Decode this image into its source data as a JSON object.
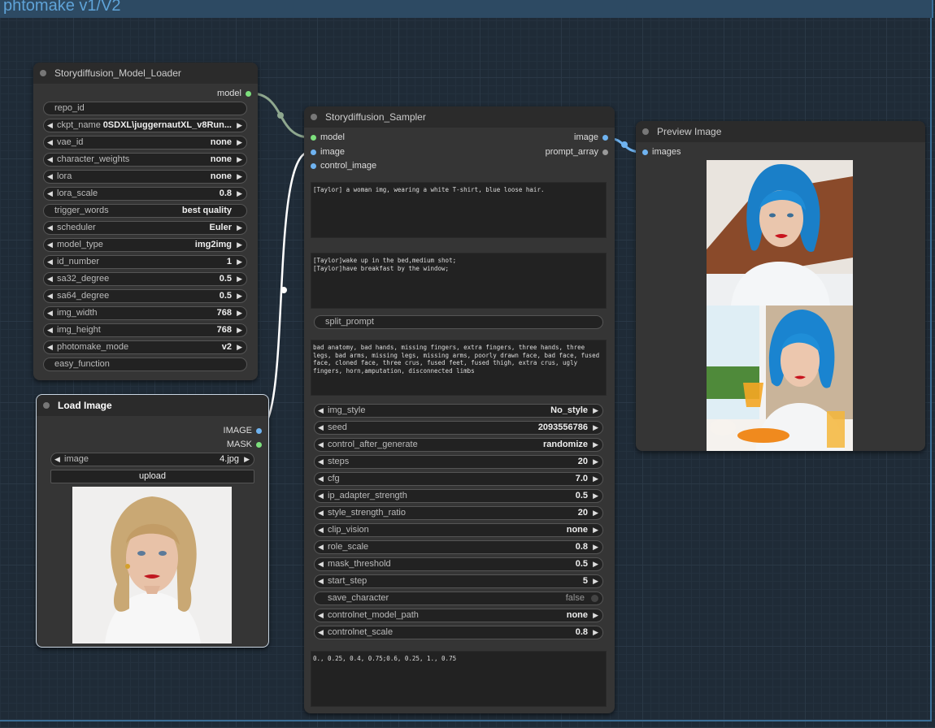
{
  "group": {
    "title": "phtomake v1/V2"
  },
  "loader": {
    "title": "Storydiffusion_Model_Loader",
    "output": "model",
    "widgets": [
      {
        "label": "repo_id",
        "value": "",
        "kind": "text"
      },
      {
        "label": "ckpt_name",
        "value": "0SDXL\\juggernautXL_v8Run...",
        "kind": "combo"
      },
      {
        "label": "vae_id",
        "value": "none",
        "kind": "combo"
      },
      {
        "label": "character_weights",
        "value": "none",
        "kind": "combo"
      },
      {
        "label": "lora",
        "value": "none",
        "kind": "combo"
      },
      {
        "label": "lora_scale",
        "value": "0.8",
        "kind": "number"
      },
      {
        "label": "trigger_words",
        "value": "best quality",
        "kind": "text"
      },
      {
        "label": "scheduler",
        "value": "Euler",
        "kind": "combo"
      },
      {
        "label": "model_type",
        "value": "img2img",
        "kind": "combo"
      },
      {
        "label": "id_number",
        "value": "1",
        "kind": "number"
      },
      {
        "label": "sa32_degree",
        "value": "0.5",
        "kind": "number"
      },
      {
        "label": "sa64_degree",
        "value": "0.5",
        "kind": "number"
      },
      {
        "label": "img_width",
        "value": "768",
        "kind": "number"
      },
      {
        "label": "img_height",
        "value": "768",
        "kind": "number"
      },
      {
        "label": "photomake_mode",
        "value": "v2",
        "kind": "combo"
      },
      {
        "label": "easy_function",
        "value": "",
        "kind": "text"
      }
    ]
  },
  "load_image": {
    "title": "Load Image",
    "outputs": [
      "IMAGE",
      "MASK"
    ],
    "image_label": "image",
    "image_value": "4.jpg",
    "upload_label": "upload"
  },
  "sampler": {
    "title": "Storydiffusion_Sampler",
    "inputs": [
      "model",
      "image",
      "control_image"
    ],
    "outputs": [
      "image",
      "prompt_array"
    ],
    "character_prompt": "[Taylor] a woman img, wearing a white T-shirt, blue loose hair.",
    "scene_prompts": "[Taylor]wake up in the bed,medium shot;\n[Taylor]have breakfast by the window;",
    "split_prompt": "split_prompt",
    "negative_prompt": "bad anatomy, bad hands, missing fingers, extra fingers, three hands, three legs, bad arms, missing legs, missing arms, poorly drawn face, bad face, fused face, cloned face, three crus, fused feet, fused thigh, extra crus, ugly fingers, horn,amputation, disconnected limbs",
    "widgets": [
      {
        "label": "img_style",
        "value": "No_style",
        "kind": "combo"
      },
      {
        "label": "seed",
        "value": "2093556786",
        "kind": "number"
      },
      {
        "label": "control_after_generate",
        "value": "randomize",
        "kind": "combo"
      },
      {
        "label": "steps",
        "value": "20",
        "kind": "number"
      },
      {
        "label": "cfg",
        "value": "7.0",
        "kind": "number"
      },
      {
        "label": "ip_adapter_strength",
        "value": "0.5",
        "kind": "number"
      },
      {
        "label": "style_strength_ratio",
        "value": "20",
        "kind": "number"
      },
      {
        "label": "clip_vision",
        "value": "none",
        "kind": "combo"
      },
      {
        "label": "role_scale",
        "value": "0.8",
        "kind": "number"
      },
      {
        "label": "mask_threshold",
        "value": "0.5",
        "kind": "number"
      },
      {
        "label": "start_step",
        "value": "5",
        "kind": "number"
      },
      {
        "label": "save_character",
        "value": "false",
        "kind": "toggle"
      },
      {
        "label": "controlnet_model_path",
        "value": "none",
        "kind": "combo"
      },
      {
        "label": "controlnet_scale",
        "value": "0.8",
        "kind": "number"
      }
    ],
    "bottom_text": "0., 0.25, 0.4, 0.75;0.6, 0.25, 1., 0.75"
  },
  "preview": {
    "title": "Preview Image",
    "input": "images"
  },
  "colors": {
    "model_pin": "#7de07d",
    "image_pin": "#6fb3f0",
    "link_model": "#8fa88f",
    "link_image": "#ffffff",
    "link_preview": "#6fb3f0"
  }
}
